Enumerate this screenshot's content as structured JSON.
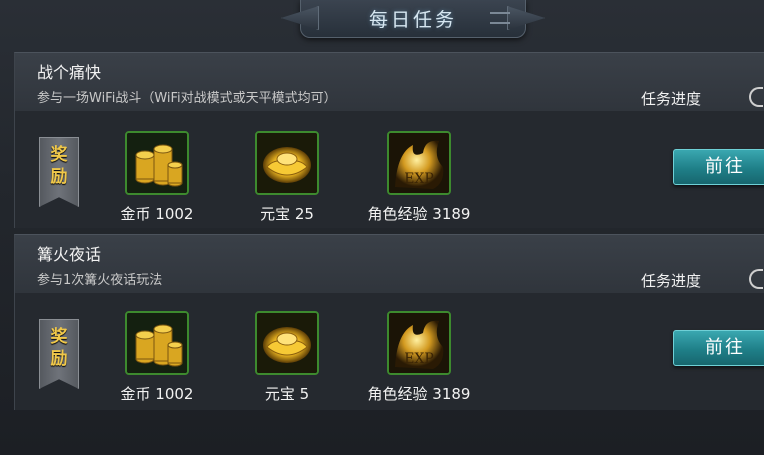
{
  "window": {
    "title": "每日任务"
  },
  "tasks": [
    {
      "name": "战个痛快",
      "description": "参与一场WiFi战斗（WiFi对战模式或天平模式均可）",
      "progress_label": "任务进度",
      "reward_label": "奖励",
      "rewards": [
        {
          "icon": "gold-coins-icon",
          "label": "金币 1002"
        },
        {
          "icon": "gold-ingot-icon",
          "label": "元宝 25"
        },
        {
          "icon": "exp-icon",
          "label": "角色经验 3189"
        }
      ],
      "button_label": "前往"
    },
    {
      "name": "篝火夜话",
      "description": "参与1次篝火夜话玩法",
      "progress_label": "任务进度",
      "reward_label": "奖励",
      "rewards": [
        {
          "icon": "gold-coins-icon",
          "label": "金币 1002"
        },
        {
          "icon": "gold-ingot-icon",
          "label": "元宝 5"
        },
        {
          "icon": "exp-icon",
          "label": "角色经验 3189"
        }
      ],
      "button_label": "前往"
    }
  ],
  "colors": {
    "accent_button": "#1f7f88",
    "reward_gold": "#f0c84a",
    "item_border": "#3d8a2e"
  }
}
